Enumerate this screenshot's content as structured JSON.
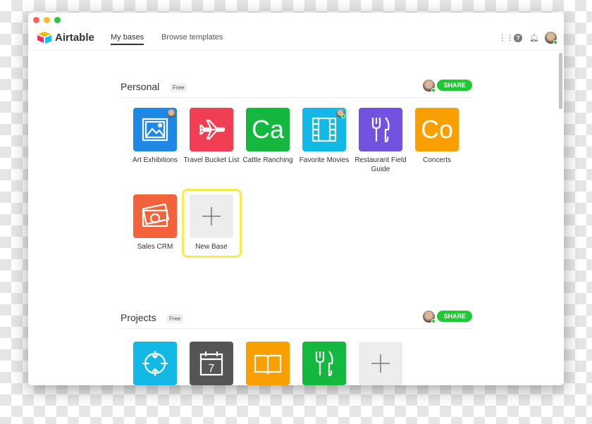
{
  "window": {
    "buttons": [
      "close",
      "minimize",
      "zoom"
    ]
  },
  "header": {
    "logo_text": "Airtable",
    "nav": [
      {
        "label": "My bases",
        "active": true
      },
      {
        "label": "Browse templates",
        "active": false
      }
    ],
    "icons": [
      "apps-grid-icon",
      "help-icon",
      "bell-icon",
      "user-avatar"
    ]
  },
  "sections": [
    {
      "title": "Personal",
      "badge": "Free",
      "share_label": "SHARE",
      "bases": [
        {
          "label": "Art Exhibitions",
          "color": "#1e88e5",
          "icon": "image-icon"
        },
        {
          "label": "Travel Bucket List",
          "color": "#f23e52",
          "icon": "airplane-icon"
        },
        {
          "label": "Cattle Ranching",
          "color": "#14b83f",
          "icon": "text",
          "text": "Ca"
        },
        {
          "label": "Favorite Movies",
          "color": "#12b9e6",
          "icon": "film-icon"
        },
        {
          "label": "Restaurant Field Guide",
          "color": "#7452e0",
          "icon": "fork-knife-icon"
        },
        {
          "label": "Concerts",
          "color": "#f9a000",
          "icon": "text",
          "text": "Co"
        },
        {
          "label": "Sales CRM",
          "color": "#f3633b",
          "icon": "money-icon"
        },
        {
          "label": "New Base",
          "color": "#ededed",
          "icon": "plus-icon"
        }
      ]
    },
    {
      "title": "Projects",
      "badge": "Free",
      "share_label": "SHARE",
      "bases": [
        {
          "color": "#12b9e6",
          "icon": "target-icon"
        },
        {
          "color": "#555555",
          "icon": "calendar-icon",
          "text": "7"
        },
        {
          "color": "#f9a000",
          "icon": "book-icon"
        },
        {
          "color": "#14b83f",
          "icon": "fork-knife-icon"
        },
        {
          "color": "#ededed",
          "icon": "plus-icon"
        }
      ]
    }
  ],
  "colors": {
    "share": "#20c933",
    "highlight": "#fce94f"
  }
}
